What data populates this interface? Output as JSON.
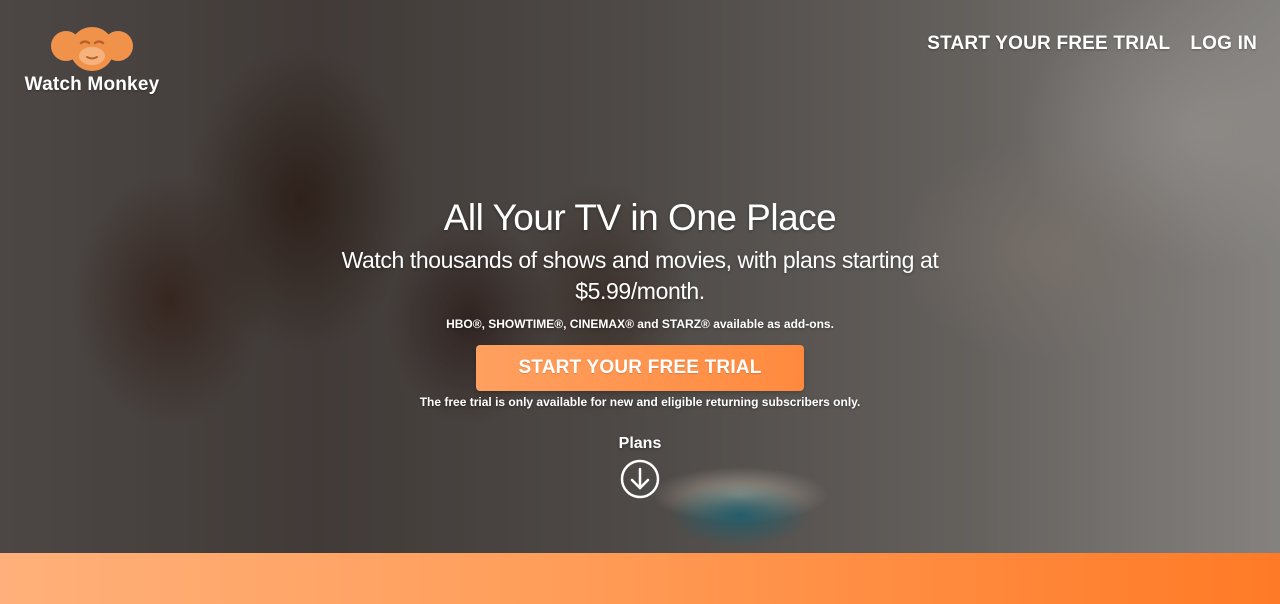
{
  "brand": {
    "name": "Watch Monkey",
    "logo_icon": "monkey-head-icon",
    "color": "#f0924a"
  },
  "nav": {
    "trial_label": "START YOUR FREE TRIAL",
    "login_label": "LOG IN"
  },
  "hero": {
    "headline": "All Your TV in One Place",
    "subhead": "Watch thousands of shows and movies, with plans starting at $5.99/month.",
    "addons": "HBO®, SHOWTIME®, CINEMAX® and STARZ® available as add-ons.",
    "cta_label": "START YOUR FREE TRIAL",
    "disclaimer": "The free trial is only available for new and eligible returning subscribers only.",
    "plans_label": "Plans",
    "plans_icon": "arrow-down-circle-icon"
  },
  "colors": {
    "accent": "#ff8a3e",
    "accent_light": "#ffa060"
  }
}
